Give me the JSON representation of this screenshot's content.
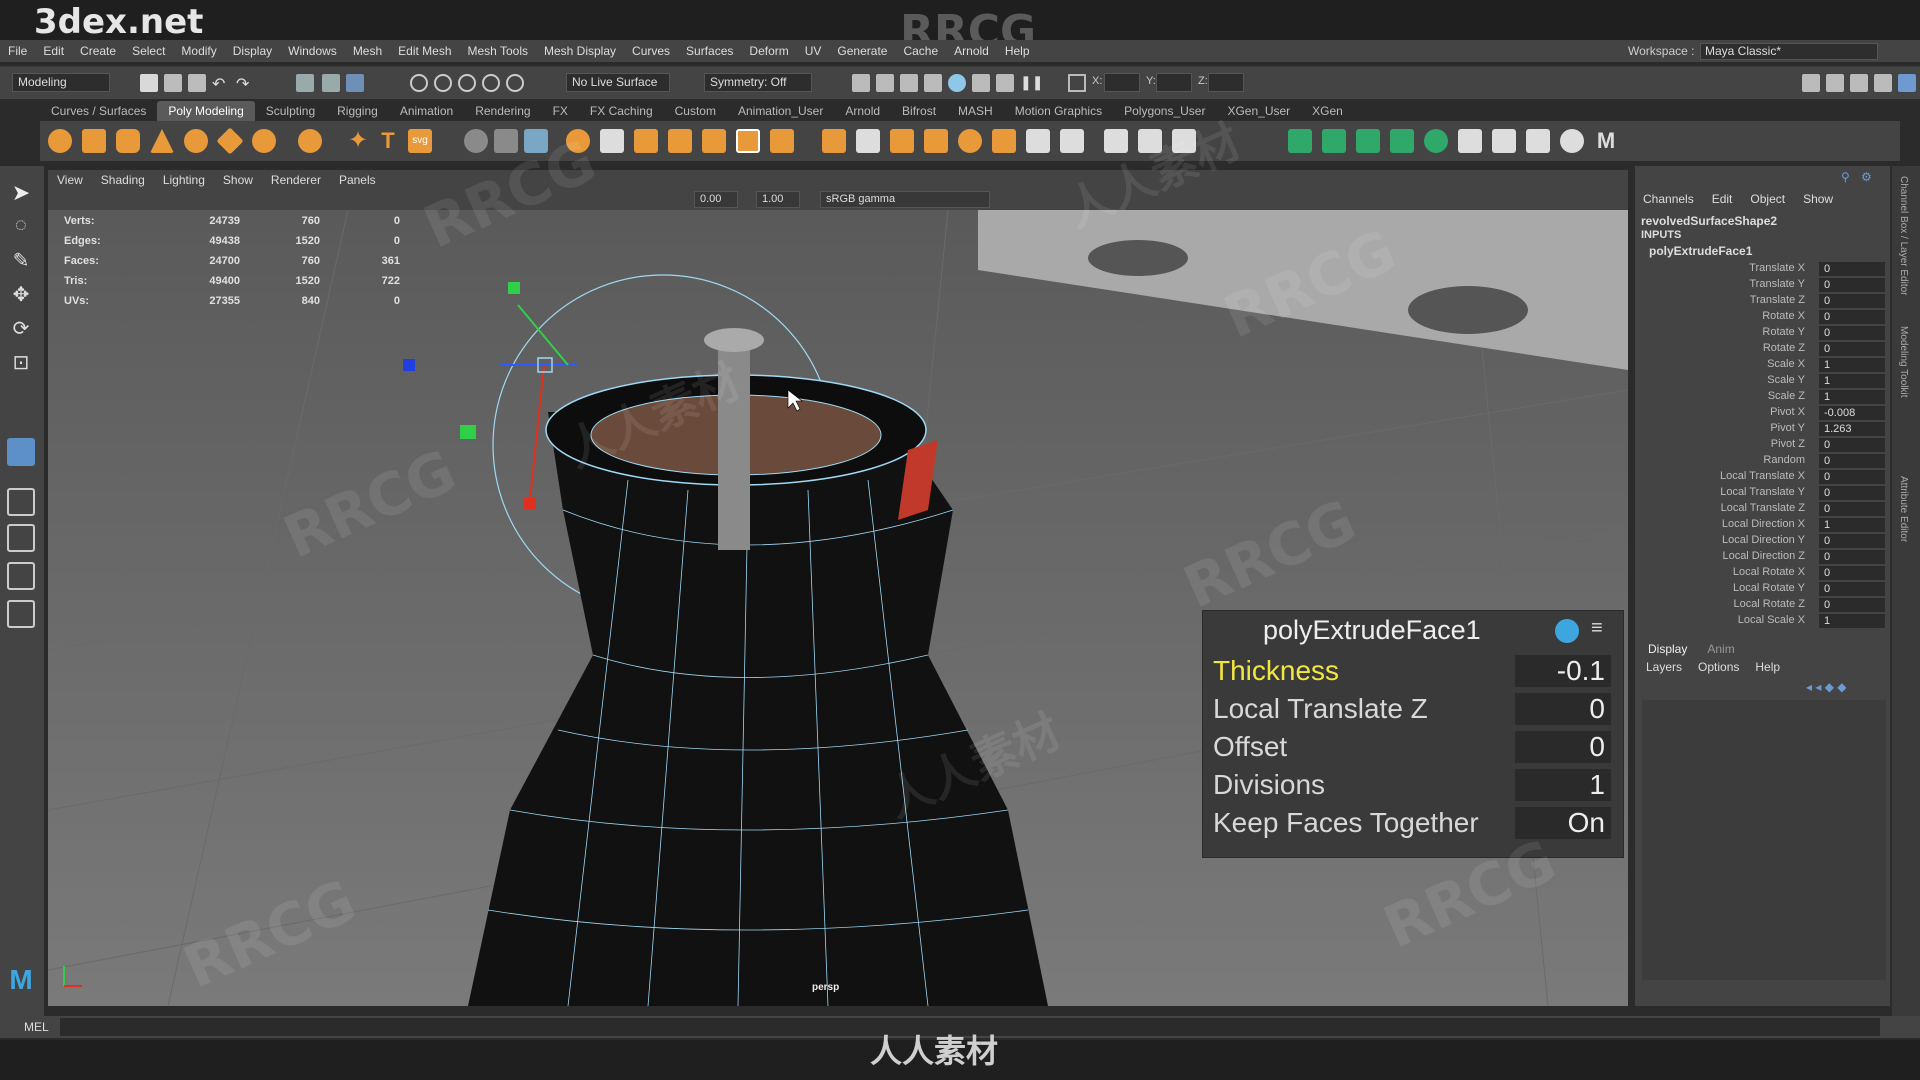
{
  "site_title": "3dex.net",
  "watermark_center": "RRCG",
  "watermark_bottom": "人人素材",
  "watermark_repeat": "RRCG",
  "watermark_repeat_cn": "人人素材",
  "menu": [
    "File",
    "Edit",
    "Create",
    "Select",
    "Modify",
    "Display",
    "Windows",
    "Mesh",
    "Edit Mesh",
    "Mesh Tools",
    "Mesh Display",
    "Curves",
    "Surfaces",
    "Deform",
    "UV",
    "Generate",
    "Cache",
    "Arnold",
    "Help"
  ],
  "workspace": {
    "label": "Workspace :",
    "value": "Maya Classic*"
  },
  "statusline": {
    "mode": "Modeling",
    "live_surface": "No Live Surface",
    "symmetry": "Symmetry: Off",
    "x_label": "X:",
    "y_label": "Y:",
    "z_label": "Z:"
  },
  "shelf_tabs": [
    "Curves / Surfaces",
    "Poly Modeling",
    "Sculpting",
    "Rigging",
    "Animation",
    "Rendering",
    "FX",
    "FX Caching",
    "Custom",
    "Animation_User",
    "Arnold",
    "Bifrost",
    "MASH",
    "Motion Graphics",
    "Polygons_User",
    "XGen_User",
    "XGen"
  ],
  "active_shelf_tab": "Poly Modeling",
  "viewport_menu": [
    "View",
    "Shading",
    "Lighting",
    "Show",
    "Renderer",
    "Panels"
  ],
  "viewport_toolbar": {
    "exposure": "0.00",
    "gamma": "1.00",
    "color_space": "sRGB gamma"
  },
  "camera_label": "persp",
  "hud_stats": [
    {
      "label": "Verts:",
      "a": "24739",
      "b": "760",
      "c": "0"
    },
    {
      "label": "Edges:",
      "a": "49438",
      "b": "1520",
      "c": "0"
    },
    {
      "label": "Faces:",
      "a": "24700",
      "b": "760",
      "c": "361"
    },
    {
      "label": "Tris:",
      "a": "49400",
      "b": "1520",
      "c": "722"
    },
    {
      "label": "UVs:",
      "a": "27355",
      "b": "840",
      "c": "0"
    }
  ],
  "hud_editor": {
    "title": "polyExtrudeFace1",
    "rows": [
      {
        "label": "Thickness",
        "value": "-0.1"
      },
      {
        "label": "Local Translate Z",
        "value": "0"
      },
      {
        "label": "Offset",
        "value": "0"
      },
      {
        "label": "Divisions",
        "value": "1"
      },
      {
        "label": "Keep Faces Together",
        "value": "On"
      }
    ]
  },
  "channel_box": {
    "menu": [
      "Channels",
      "Edit",
      "Object",
      "Show"
    ],
    "node": "revolvedSurfaceShape2",
    "inputs_label": "INPUTS",
    "input_node": "polyExtrudeFace1",
    "attributes": [
      {
        "name": "Translate X",
        "value": "0"
      },
      {
        "name": "Translate Y",
        "value": "0"
      },
      {
        "name": "Translate Z",
        "value": "0"
      },
      {
        "name": "Rotate X",
        "value": "0"
      },
      {
        "name": "Rotate Y",
        "value": "0"
      },
      {
        "name": "Rotate Z",
        "value": "0"
      },
      {
        "name": "Scale X",
        "value": "1"
      },
      {
        "name": "Scale Y",
        "value": "1"
      },
      {
        "name": "Scale Z",
        "value": "1"
      },
      {
        "name": "Pivot X",
        "value": "-0.008"
      },
      {
        "name": "Pivot Y",
        "value": "1.263"
      },
      {
        "name": "Pivot Z",
        "value": "0"
      },
      {
        "name": "Random",
        "value": "0"
      },
      {
        "name": "Local Translate X",
        "value": "0"
      },
      {
        "name": "Local Translate Y",
        "value": "0"
      },
      {
        "name": "Local Translate Z",
        "value": "0"
      },
      {
        "name": "Local Direction X",
        "value": "1"
      },
      {
        "name": "Local Direction Y",
        "value": "0"
      },
      {
        "name": "Local Direction Z",
        "value": "0"
      },
      {
        "name": "Local Rotate X",
        "value": "0"
      },
      {
        "name": "Local Rotate Y",
        "value": "0"
      },
      {
        "name": "Local Rotate Z",
        "value": "0"
      },
      {
        "name": "Local Scale X",
        "value": "1"
      }
    ]
  },
  "layer_panel": {
    "tabs": [
      "Display",
      "Anim"
    ],
    "menu": [
      "Layers",
      "Options",
      "Help"
    ]
  },
  "side_tabs": [
    "Channel Box / Layer Editor",
    "Modeling Toolkit",
    "Attribute Editor"
  ],
  "command_line": {
    "label": "MEL"
  },
  "colors": {
    "panel": "#444444",
    "viewport": "#6e6e6e",
    "highlight": "#f2e640",
    "wire": "#9fd8f5"
  }
}
